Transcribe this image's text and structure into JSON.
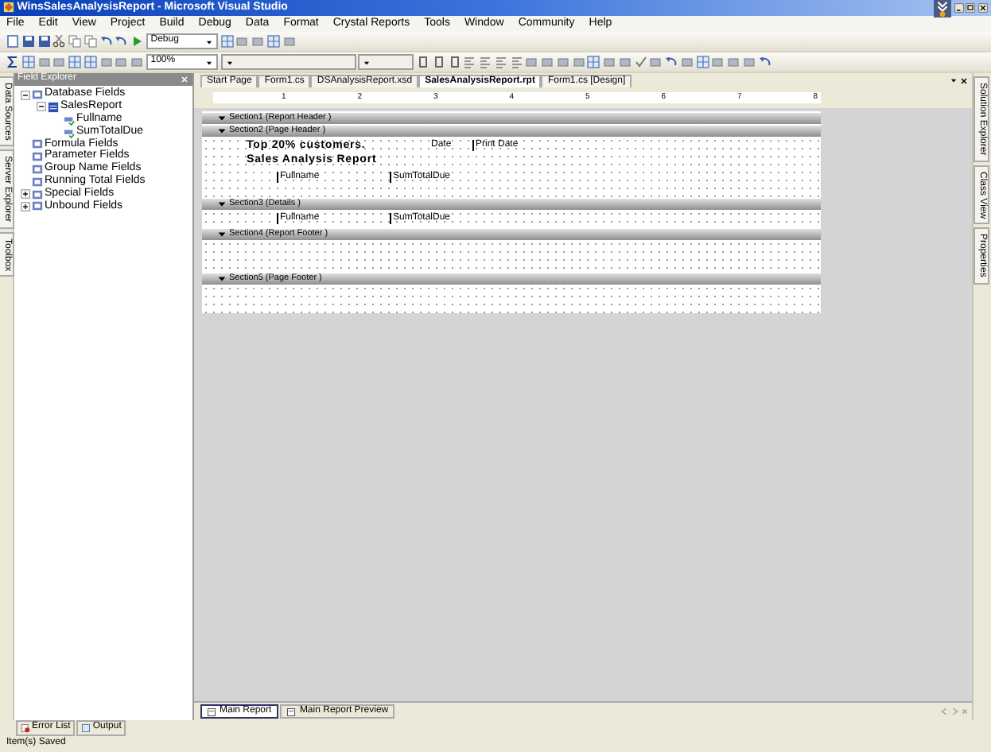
{
  "window": {
    "title": "WinsSalesAnalysisReport - Microsoft Visual Studio"
  },
  "menu": [
    "File",
    "Edit",
    "View",
    "Project",
    "Build",
    "Debug",
    "Data",
    "Format",
    "Crystal Reports",
    "Tools",
    "Window",
    "Community",
    "Help"
  ],
  "toolbar": {
    "configuration": "Debug",
    "zoom": "100%"
  },
  "left_tabs": [
    "Data Sources",
    "Server Explorer",
    "Toolbox"
  ],
  "field_explorer": {
    "title": "Field Explorer",
    "tree": [
      {
        "label": "Database Fields",
        "expanded": true,
        "children": [
          {
            "label": "SalesReport",
            "expanded": true,
            "children": [
              {
                "label": "Fullname"
              },
              {
                "label": "SumTotalDue"
              }
            ]
          }
        ]
      },
      {
        "label": "Formula Fields"
      },
      {
        "label": "Parameter Fields"
      },
      {
        "label": "Group Name Fields"
      },
      {
        "label": "Running Total Fields"
      },
      {
        "label": "Special Fields",
        "expanded": false
      },
      {
        "label": "Unbound Fields",
        "expanded": false
      }
    ]
  },
  "doc_tabs": [
    {
      "label": "Start Page",
      "selected": false
    },
    {
      "label": "Form1.cs",
      "selected": false
    },
    {
      "label": "DSAnalysisReport.xsd",
      "selected": false
    },
    {
      "label": "SalesAnalysisReport.rpt",
      "selected": true
    },
    {
      "label": "Form1.cs [Design]",
      "selected": false
    }
  ],
  "ruler": [
    "1",
    "2",
    "3",
    "4",
    "5",
    "6",
    "7",
    "8"
  ],
  "report": {
    "sections": [
      {
        "label": "Section1 (Report Header )",
        "kind": "bar"
      },
      {
        "label": "Section2 (Page Header )",
        "kind": "band",
        "rows": [
          [
            {
              "kind": "heading",
              "text": "Top 20% customers."
            },
            {
              "kind": "label",
              "text": "Date"
            },
            {
              "kind": "field",
              "text": "Print Date"
            }
          ],
          [
            {
              "kind": "heading",
              "text": "Sales Analysis Report"
            }
          ],
          [
            {
              "kind": "field",
              "text": "Fullname"
            },
            {
              "kind": "field",
              "text": "SumTotalDue"
            }
          ]
        ]
      },
      {
        "label": "Section3 (Details )",
        "kind": "band",
        "rows": [
          [
            {
              "kind": "field",
              "text": "Fullname"
            },
            {
              "kind": "field",
              "text": "SumTotalDue"
            }
          ]
        ]
      },
      {
        "label": "Section4 (Report Footer )",
        "kind": "band"
      },
      {
        "label": "Section5 (Page Footer )",
        "kind": "band"
      }
    ]
  },
  "view_tabs": [
    {
      "label": "Main Report",
      "selected": true
    },
    {
      "label": "Main Report Preview",
      "selected": false
    }
  ],
  "right_tabs": [
    "Solution Explorer",
    "Class View",
    "Properties"
  ],
  "bottom_tabs": [
    "Error List",
    "Output"
  ],
  "status_bar": "Item(s) Saved"
}
